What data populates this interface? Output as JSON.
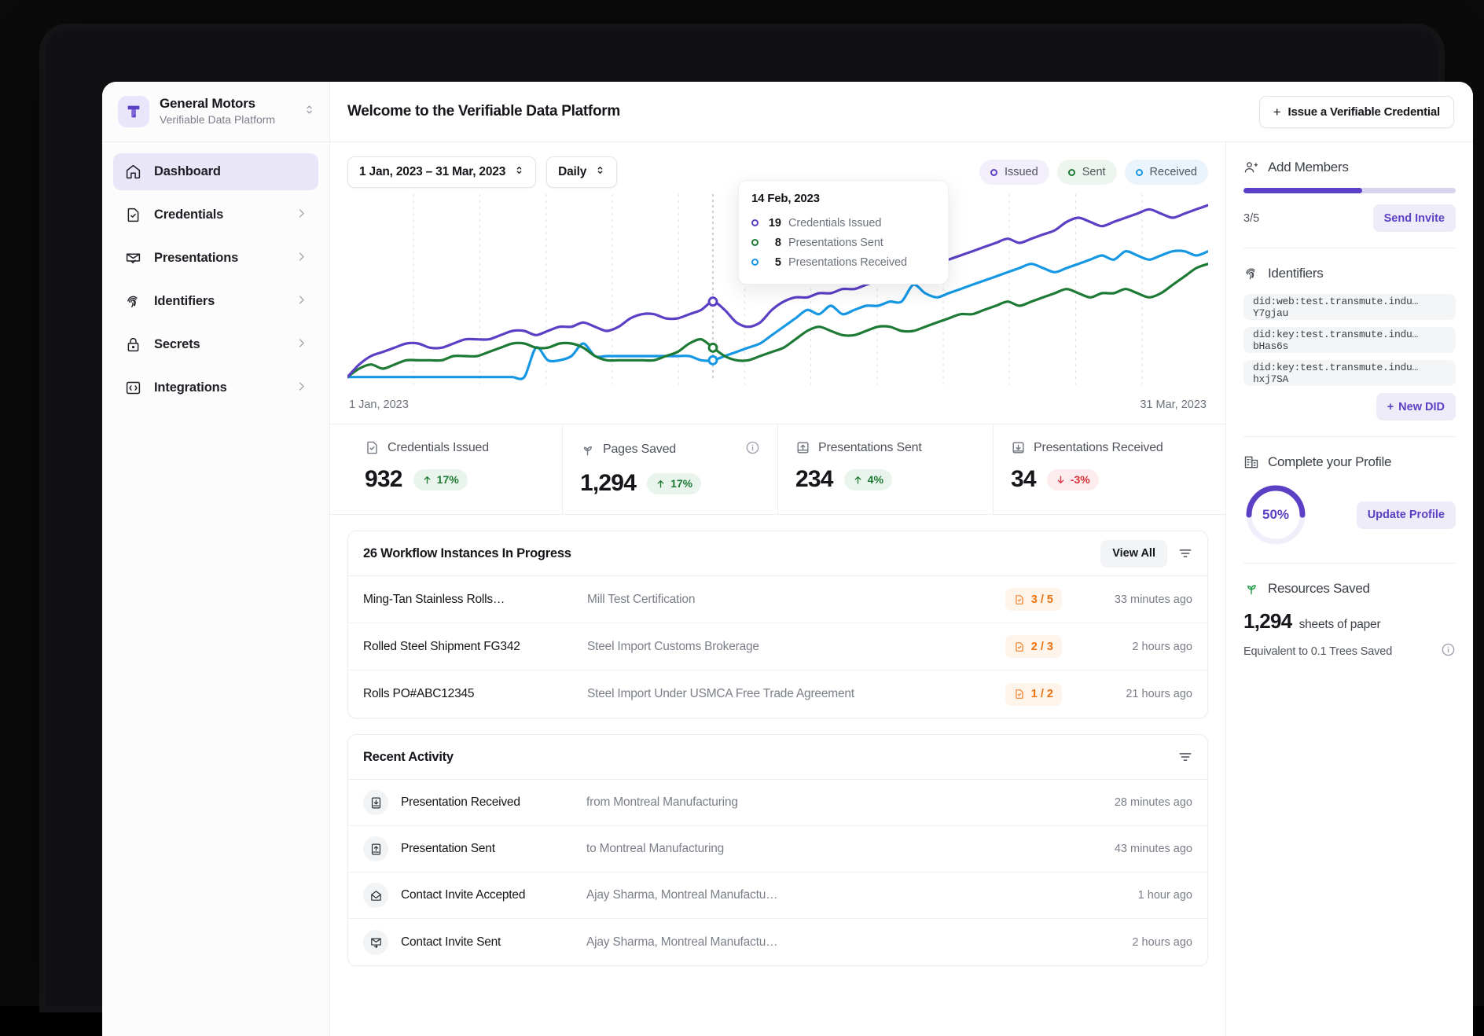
{
  "sidebar": {
    "org": {
      "name": "General Motors",
      "subtitle": "Verifiable Data Platform",
      "logo_icon": "transmute-logo-icon",
      "switcher_icon": "chevron-updown-icon"
    },
    "items": [
      {
        "label": "Dashboard",
        "icon": "home-icon",
        "active": true,
        "chevron": false
      },
      {
        "label": "Credentials",
        "icon": "document-check-icon",
        "active": false,
        "chevron": true
      },
      {
        "label": "Presentations",
        "icon": "envelope-check-icon",
        "active": false,
        "chevron": true
      },
      {
        "label": "Identifiers",
        "icon": "fingerprint-icon",
        "active": false,
        "chevron": true
      },
      {
        "label": "Secrets",
        "icon": "lock-icon",
        "active": false,
        "chevron": true
      },
      {
        "label": "Integrations",
        "icon": "code-brackets-icon",
        "active": false,
        "chevron": true
      }
    ]
  },
  "header": {
    "title": "Welcome to the Verifiable Data Platform",
    "issue_button": {
      "label": "Issue a Verifiable Credential",
      "icon": "plus-icon"
    }
  },
  "chart_controls": {
    "date_range": "1 Jan, 2023 – 31 Mar, 2023",
    "interval": "Daily",
    "legend": [
      {
        "label": "Issued",
        "color": "#5b3fc4"
      },
      {
        "label": "Sent",
        "color": "#1d7a34"
      },
      {
        "label": "Received",
        "color": "#1597e4"
      }
    ]
  },
  "tooltip": {
    "date": "14 Feb, 2023",
    "rows": [
      {
        "value": "19",
        "label": "Credentials Issued",
        "color": "#5b3fc4"
      },
      {
        "value": "8",
        "label": "Presentations Sent",
        "color": "#1d7a34"
      },
      {
        "value": "5",
        "label": "Presentations Received",
        "color": "#1597e4"
      }
    ]
  },
  "chart_data": {
    "type": "line",
    "title": "",
    "xlabel": "",
    "ylabel": "",
    "grid": "vertical-dotted",
    "legend_position": "top-right",
    "x_axis_start": "1 Jan, 2023",
    "x_axis_end": "31 Mar, 2023",
    "highlight": {
      "date": "14 Feb, 2023",
      "issued": 19,
      "sent": 8,
      "received": 5
    },
    "series": [
      {
        "name": "Credentials Issued",
        "color": "#5b3fc4",
        "values": [
          1,
          4,
          6,
          7,
          8,
          9,
          9,
          8,
          8,
          9,
          10,
          10,
          10,
          11,
          12,
          12,
          11,
          12,
          13,
          13,
          14,
          13,
          12,
          13,
          15,
          16,
          16,
          15,
          15,
          16,
          17,
          19,
          17,
          14,
          13,
          14,
          17,
          19,
          20,
          20,
          21,
          21,
          22,
          22,
          23,
          24,
          25,
          26,
          27,
          27,
          28,
          29,
          30,
          31,
          32,
          33,
          34,
          33,
          34,
          35,
          36,
          38,
          39,
          38,
          37,
          38,
          39,
          40,
          41,
          40,
          39,
          40,
          41,
          42
        ]
      },
      {
        "name": "Presentations Sent",
        "color": "#1d7a34",
        "values": [
          1,
          3,
          4,
          3,
          4,
          5,
          5,
          5,
          5,
          6,
          6,
          6,
          7,
          8,
          9,
          9,
          8,
          8,
          9,
          9,
          8,
          6,
          5,
          5,
          5,
          5,
          5,
          6,
          7,
          9,
          10,
          8,
          6,
          5,
          5,
          6,
          7,
          8,
          10,
          12,
          13,
          12,
          11,
          11,
          12,
          13,
          13,
          12,
          12,
          13,
          14,
          15,
          16,
          16,
          17,
          18,
          19,
          18,
          19,
          20,
          21,
          22,
          21,
          20,
          21,
          21,
          22,
          21,
          20,
          21,
          23,
          25,
          27,
          28
        ]
      },
      {
        "name": "Presentations Received",
        "color": "#1597e4",
        "values": [
          1,
          1,
          1,
          1,
          1,
          1,
          1,
          1,
          1,
          1,
          1,
          1,
          1,
          1,
          1,
          1,
          8,
          5,
          5,
          6,
          9,
          6,
          6,
          6,
          6,
          6,
          6,
          6,
          6,
          6,
          5,
          5,
          6,
          7,
          8,
          9,
          11,
          13,
          15,
          17,
          16,
          18,
          16,
          17,
          18,
          18,
          19,
          19,
          23,
          21,
          20,
          21,
          22,
          23,
          24,
          25,
          26,
          27,
          28,
          27,
          26,
          27,
          28,
          29,
          30,
          29,
          31,
          30,
          29,
          30,
          31,
          31,
          30,
          31
        ]
      }
    ]
  },
  "axis": {
    "start": "1 Jan, 2023",
    "end": "31 Mar, 2023"
  },
  "kpis": [
    {
      "title": "Credentials Issued",
      "icon": "document-check-icon",
      "value": "932",
      "delta": "17%",
      "direction": "up",
      "info": false
    },
    {
      "title": "Pages Saved",
      "icon": "sprout-icon",
      "value": "1,294",
      "delta": "17%",
      "direction": "up",
      "info": true
    },
    {
      "title": "Presentations Sent",
      "icon": "upload-tray-icon",
      "value": "234",
      "delta": "4%",
      "direction": "up",
      "info": false
    },
    {
      "title": "Presentations Received",
      "icon": "download-tray-icon",
      "value": "34",
      "delta": "-3%",
      "direction": "down",
      "info": false
    }
  ],
  "workflows": {
    "title": "26 Workflow Instances In Progress",
    "view_all": "View All",
    "filter_icon": "filter-icon",
    "rows": [
      {
        "name": "Ming-Tan Stainless Rolls…",
        "description": "Mill Test Certification",
        "progress": "3 / 5",
        "time": "33 minutes ago"
      },
      {
        "name": "Rolled Steel Shipment FG342",
        "description": "Steel Import Customs Brokerage",
        "progress": "2 / 3",
        "time": "2 hours ago"
      },
      {
        "name": "Rolls PO#ABC12345",
        "description": "Steel Import Under USMCA Free Trade Agreement",
        "progress": "1 / 2",
        "time": "21 hours ago"
      }
    ]
  },
  "activity": {
    "title": "Recent Activity",
    "filter_icon": "filter-icon",
    "rows": [
      {
        "name": "Presentation Received",
        "icon": "download-tray-icon",
        "description": "from Montreal Manufacturing",
        "time": "28 minutes ago"
      },
      {
        "name": "Presentation Sent",
        "icon": "upload-tray-icon",
        "description": "to Montreal Manufacturing",
        "time": "43 minutes ago"
      },
      {
        "name": "Contact Invite Accepted",
        "icon": "envelope-open-icon",
        "description": "Ajay Sharma, Montreal Manufactu…",
        "time": "1 hour ago"
      },
      {
        "name": "Contact Invite Sent",
        "icon": "envelope-arrow-icon",
        "description": "Ajay Sharma, Montreal Manufactu…",
        "time": "2 hours ago"
      }
    ]
  },
  "rail": {
    "members": {
      "title": "Add Members",
      "icon": "users-add-icon",
      "progress_label": "3/5",
      "progress_percent": 56,
      "button": "Send Invite"
    },
    "identifiers": {
      "title": "Identifiers",
      "icon": "fingerprint-icon",
      "dids": [
        "did:web:test.transmute.indu…Y7gjau",
        "did:key:test.transmute.indu…bHas6s",
        "did:key:test.transmute.indu…hxj7SA"
      ],
      "new_button": "New DID",
      "new_button_icon": "plus-icon"
    },
    "profile": {
      "title": "Complete your Profile",
      "icon": "building-icon",
      "percent_label": "50%",
      "percent": 50,
      "button": "Update Profile"
    },
    "resources": {
      "title": "Resources Saved",
      "icon": "sprout-icon",
      "value": "1,294",
      "unit": "sheets of paper",
      "equivalent": "Equivalent to 0.1 Trees Saved",
      "info_icon": "info-icon"
    }
  },
  "colors": {
    "accent": "#5b3fc4",
    "green": "#1d7a34",
    "blue": "#1597e4",
    "orange": "#ec7211",
    "red": "#d8303a"
  }
}
